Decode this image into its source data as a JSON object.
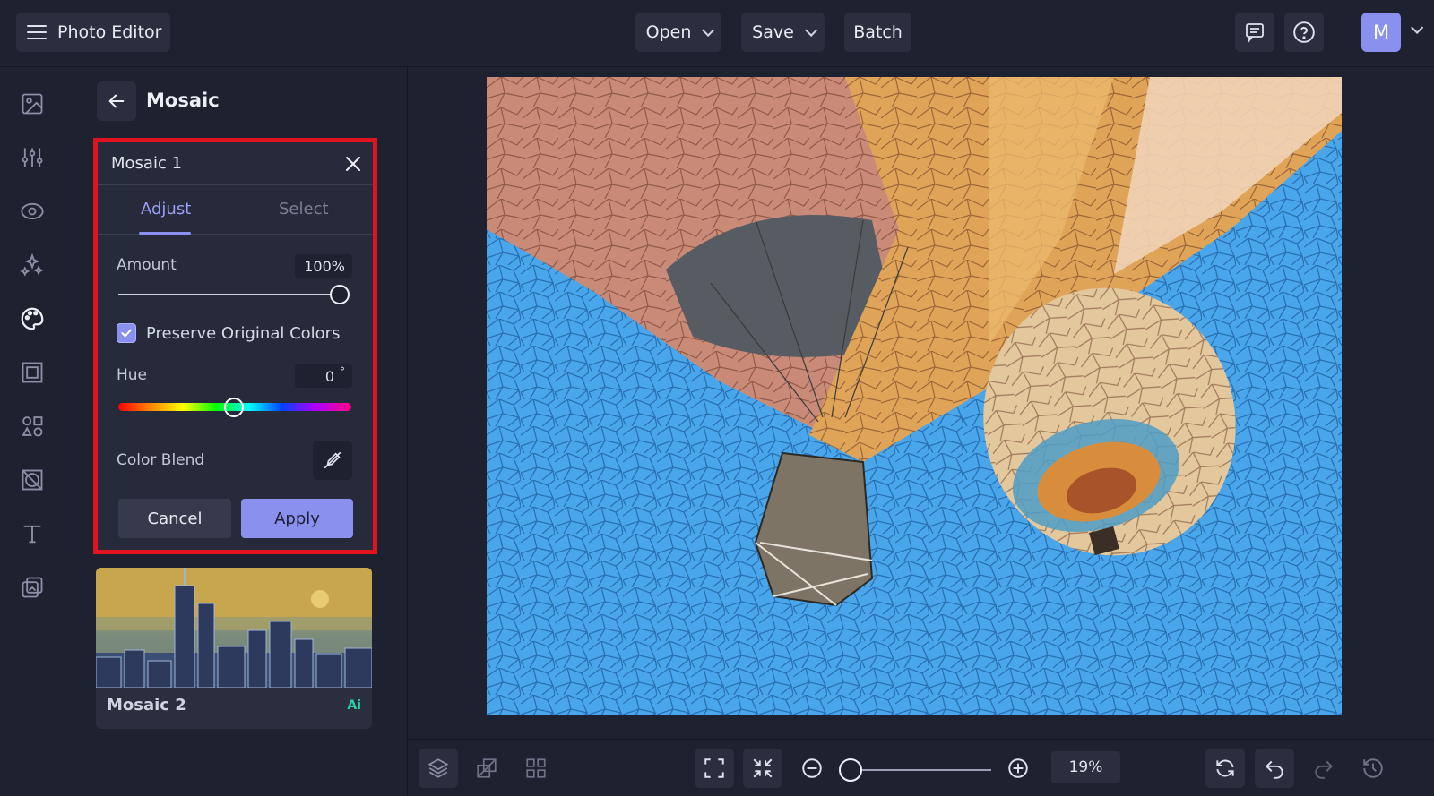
{
  "app": {
    "title": "Photo Editor"
  },
  "toolbar": {
    "open_label": "Open",
    "save_label": "Save",
    "batch_label": "Batch",
    "avatar_initial": "M"
  },
  "panel": {
    "title": "Mosaic",
    "card": {
      "title": "Mosaic 1",
      "tabs": [
        {
          "label": "Adjust",
          "active": true
        },
        {
          "label": "Select",
          "active": false
        }
      ],
      "amount": {
        "label": "Amount",
        "value_text": "100%",
        "value": 1.0
      },
      "preserve_colors": {
        "label": "Preserve Original Colors",
        "checked": true
      },
      "hue": {
        "label": "Hue",
        "value_text": "0",
        "unit": "°"
      },
      "color_blend": {
        "label": "Color Blend"
      },
      "cancel_label": "Cancel",
      "apply_label": "Apply"
    },
    "presets": [
      {
        "name": "Mosaic 2",
        "badge": "Ai"
      }
    ]
  },
  "zoom": {
    "value_text": "19%"
  },
  "colors": {
    "accent": "#8a90ee",
    "highlight": "#e0131e",
    "ai_badge": "#28d3a3",
    "sky": "#4aa6ea"
  }
}
